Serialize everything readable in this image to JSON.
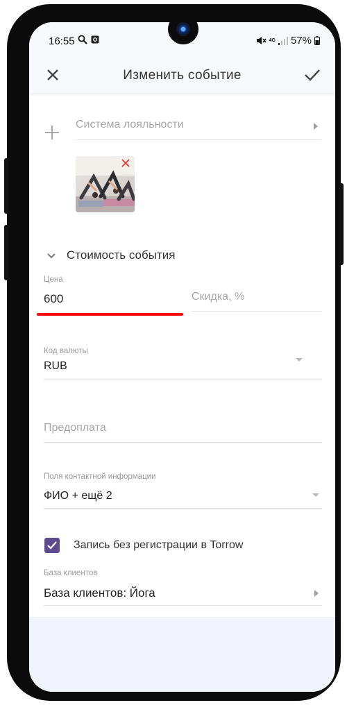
{
  "status_bar": {
    "time": "16:55",
    "network": "4G",
    "battery": "57%"
  },
  "app_bar": {
    "title": "Изменить событие",
    "close_icon": "close-icon",
    "save_icon": "check-icon"
  },
  "loyalty": {
    "label": "Система лояльности"
  },
  "cost_section": {
    "title": "Стоимость события"
  },
  "price_field": {
    "label": "Цена",
    "value": "600"
  },
  "discount_field": {
    "placeholder": "Скидка, %"
  },
  "currency_field": {
    "label": "Код валюты",
    "value": "RUB"
  },
  "prepayment_field": {
    "placeholder": "Предоплата"
  },
  "contact_fields": {
    "label": "Поля контактной информации",
    "value": "ФИО + ещё 2"
  },
  "no_registration": {
    "label": "Запись без регистрации в Torrow",
    "checked": true
  },
  "client_base": {
    "label": "База клиентов",
    "value": "База клиентов: Йога"
  },
  "colors": {
    "accent": "#5e4a8f",
    "highlight": "#ff0000"
  }
}
